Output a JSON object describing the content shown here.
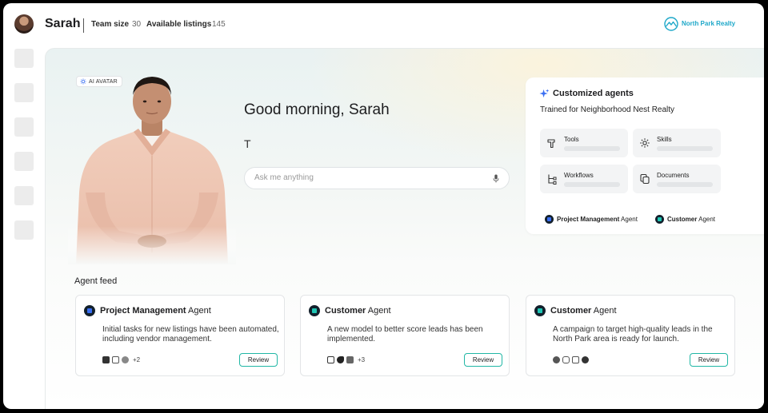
{
  "header": {
    "user_name": "Sarah",
    "team_size_label": "Team size",
    "team_size_value": "30",
    "listings_label": "Available listings",
    "listings_value": "145",
    "brand_name": "North Park Realty",
    "brand_color": "#1ea8c9"
  },
  "hero": {
    "badge": "AI AVATAR",
    "greeting": "Good morning, Sarah",
    "typed_text": "T",
    "ask_placeholder": "Ask me anything"
  },
  "agents_card": {
    "title": "Customized agents",
    "subtitle": "Trained for Neighborhood Nest Realty",
    "tiles": [
      {
        "label": "Tools",
        "icon": "hammer-icon"
      },
      {
        "label": "Skills",
        "icon": "gear-icon"
      },
      {
        "label": "Workflows",
        "icon": "workflow-icon"
      },
      {
        "label": "Documents",
        "icon": "documents-icon"
      }
    ],
    "agents": [
      {
        "name": "Project Management",
        "suffix": "Agent"
      },
      {
        "name": "Customer",
        "suffix": "Agent"
      }
    ]
  },
  "feed": {
    "title": "Agent feed",
    "cards": [
      {
        "name": "Project Management",
        "suffix": "Agent",
        "body": "Initial tasks for new listings have been automated, including vendor management.",
        "more": "+2",
        "review": "Review"
      },
      {
        "name": "Customer",
        "suffix": "Agent",
        "body": "A new model to better score leads has been implemented.",
        "more": "+3",
        "review": "Review"
      },
      {
        "name": "Customer",
        "suffix": "Agent",
        "body": "A campaign to target high-quality leads in the North Park area is ready for launch.",
        "more": "",
        "review": "Review"
      }
    ]
  },
  "colors": {
    "accent_teal": "#21b7a5",
    "agent_pm_blue": "#3a6ff2",
    "agent_customer_teal": "#1fc6b4"
  }
}
